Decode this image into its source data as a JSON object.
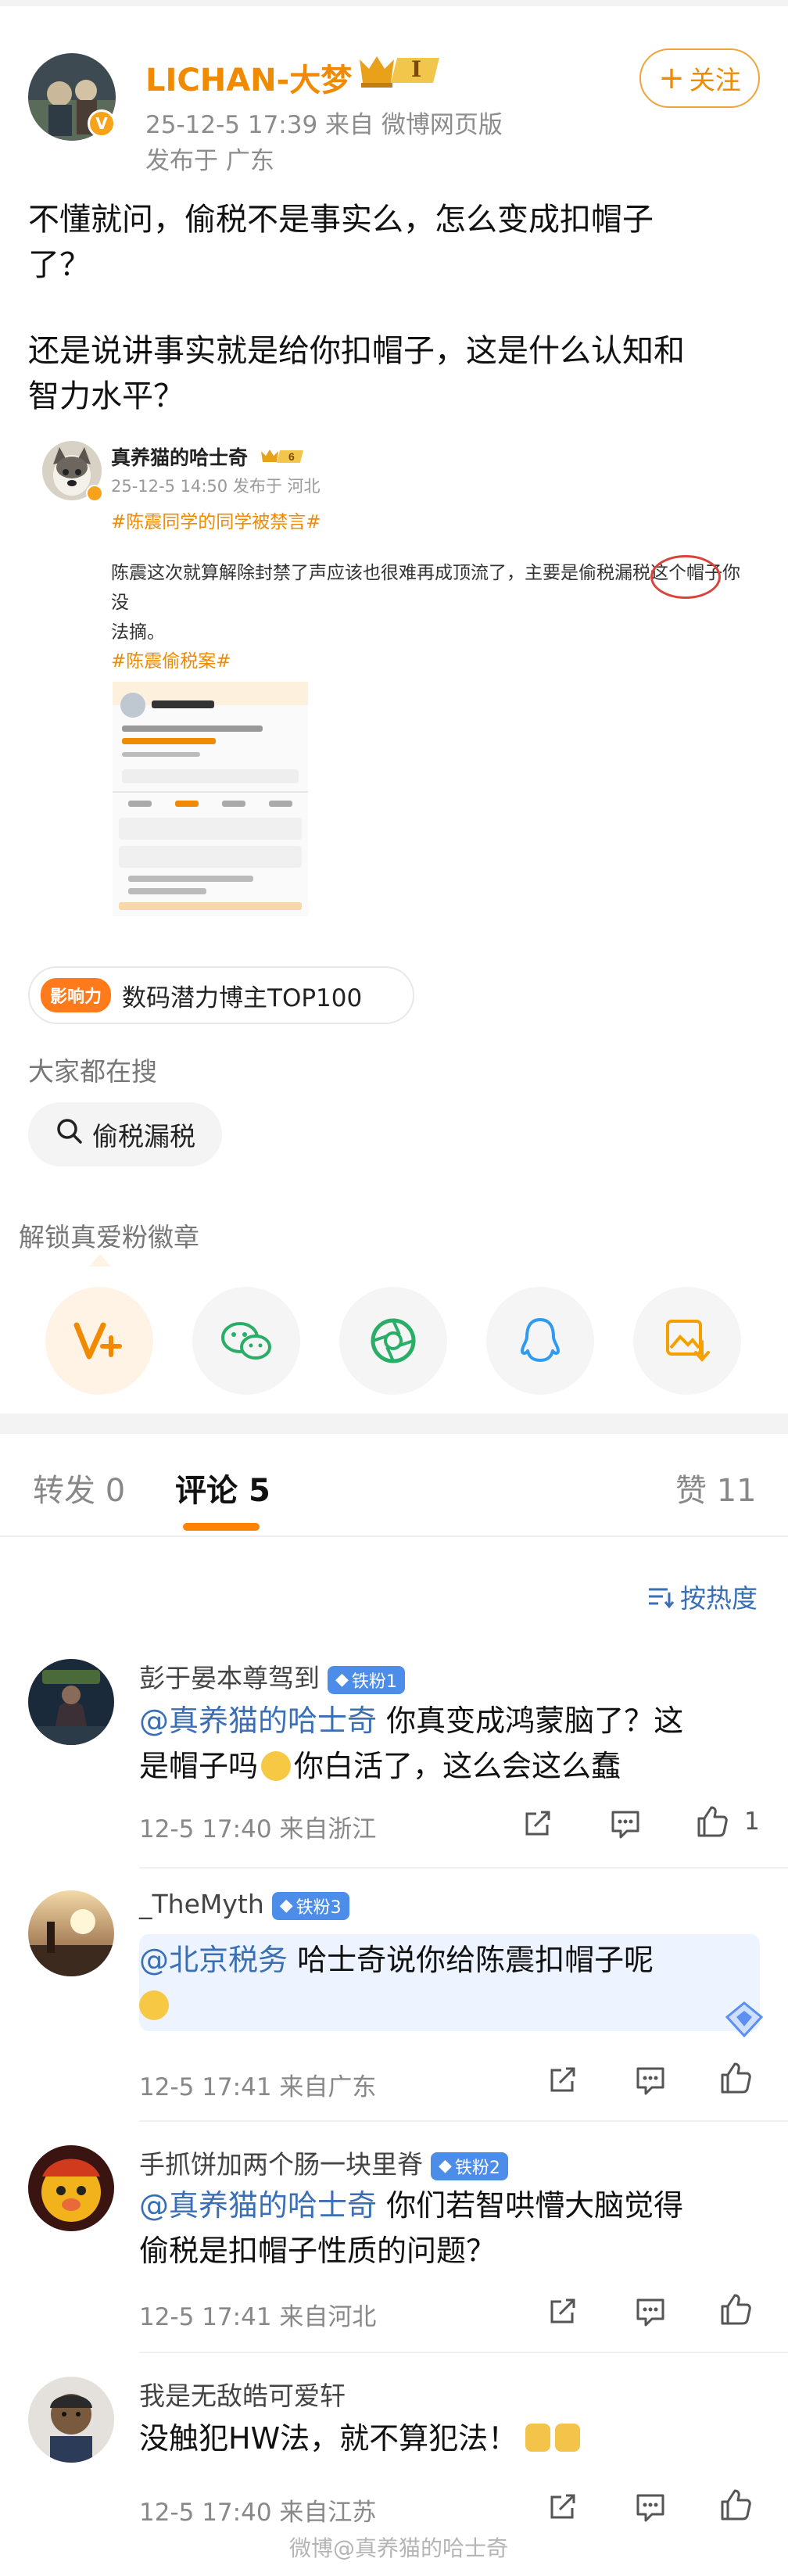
{
  "post": {
    "author": "LICHAN-大梦",
    "level_badge": "I",
    "follow_label": "关注",
    "time_source": "25-12-5 17:39 来自 微博网页版",
    "location": "发布于 广东",
    "text_p1_line1": "不懂就问，偷税不是事实么，怎么变成扣帽子",
    "text_p1_line2": "了？",
    "text_p2_line1": "还是说讲事实就是给你扣帽子，这是什么认知和",
    "text_p2_line2": "智力水平？"
  },
  "quoted": {
    "author": "真养猫的哈士奇",
    "level_badge": "6",
    "meta": "25-12-5 14:50 发布于 河北",
    "tag1": "#陈震同学的同学被禁言#",
    "text_line1": "陈震这次就算解除封禁了声应该也很难再成顶流了，主要是偷税漏税这个帽子你没",
    "text_line2": "法摘。",
    "tag2": "#陈震偷税案#"
  },
  "influence": {
    "tag": "影响力",
    "text": "数码潜力博主TOP100"
  },
  "search": {
    "title": "大家都在搜",
    "item": "偷税漏税"
  },
  "fan_badge": {
    "title": "解锁真爱粉徽章"
  },
  "share_icons": [
    "v-plus-icon",
    "wechat-icon",
    "moments-icon",
    "qq-icon",
    "save-image-icon"
  ],
  "tabs": {
    "repost": "转发",
    "repost_count": "0",
    "comments": "评论",
    "comment_count": "5",
    "likes": "赞",
    "like_count": "11"
  },
  "sort_label": "按热度",
  "comments": [
    {
      "name": "彭于晏本尊驾到",
      "fan": "铁粉1",
      "mention": "@真养猫的哈士奇",
      "line1": " 你真变成鸿蒙脑了？这",
      "line2a": "是帽子吗",
      "line2b": "你白活了，这么会这么蠢",
      "meta": "12-5 17:40 来自浙江",
      "likes": "1"
    },
    {
      "name": "_TheMyth",
      "fan": "铁粉3",
      "mention": "@北京税务",
      "line1": " 哈士奇说你给陈震扣帽子呢",
      "meta": "12-5 17:41 来自广东",
      "likes": ""
    },
    {
      "name": "手抓饼加两个肠一块里脊",
      "fan": "铁粉2",
      "mention": "@真养猫的哈士奇",
      "line1": " 你们若智哄懵大脑觉得",
      "line2": "偷税是扣帽子性质的问题？",
      "meta": "12-5 17:41 来自河北",
      "likes": ""
    },
    {
      "name": "我是无敌皓可爱轩",
      "text": "没触犯HW法，就不算犯法！",
      "meta": "12-5 17:40 来自江苏",
      "likes": ""
    }
  ],
  "watermark": "微博@真养猫的哈士奇",
  "colors": {
    "accent": "#ff8200",
    "link": "#3a6fb5",
    "fan_badge": "#4d8dea"
  }
}
